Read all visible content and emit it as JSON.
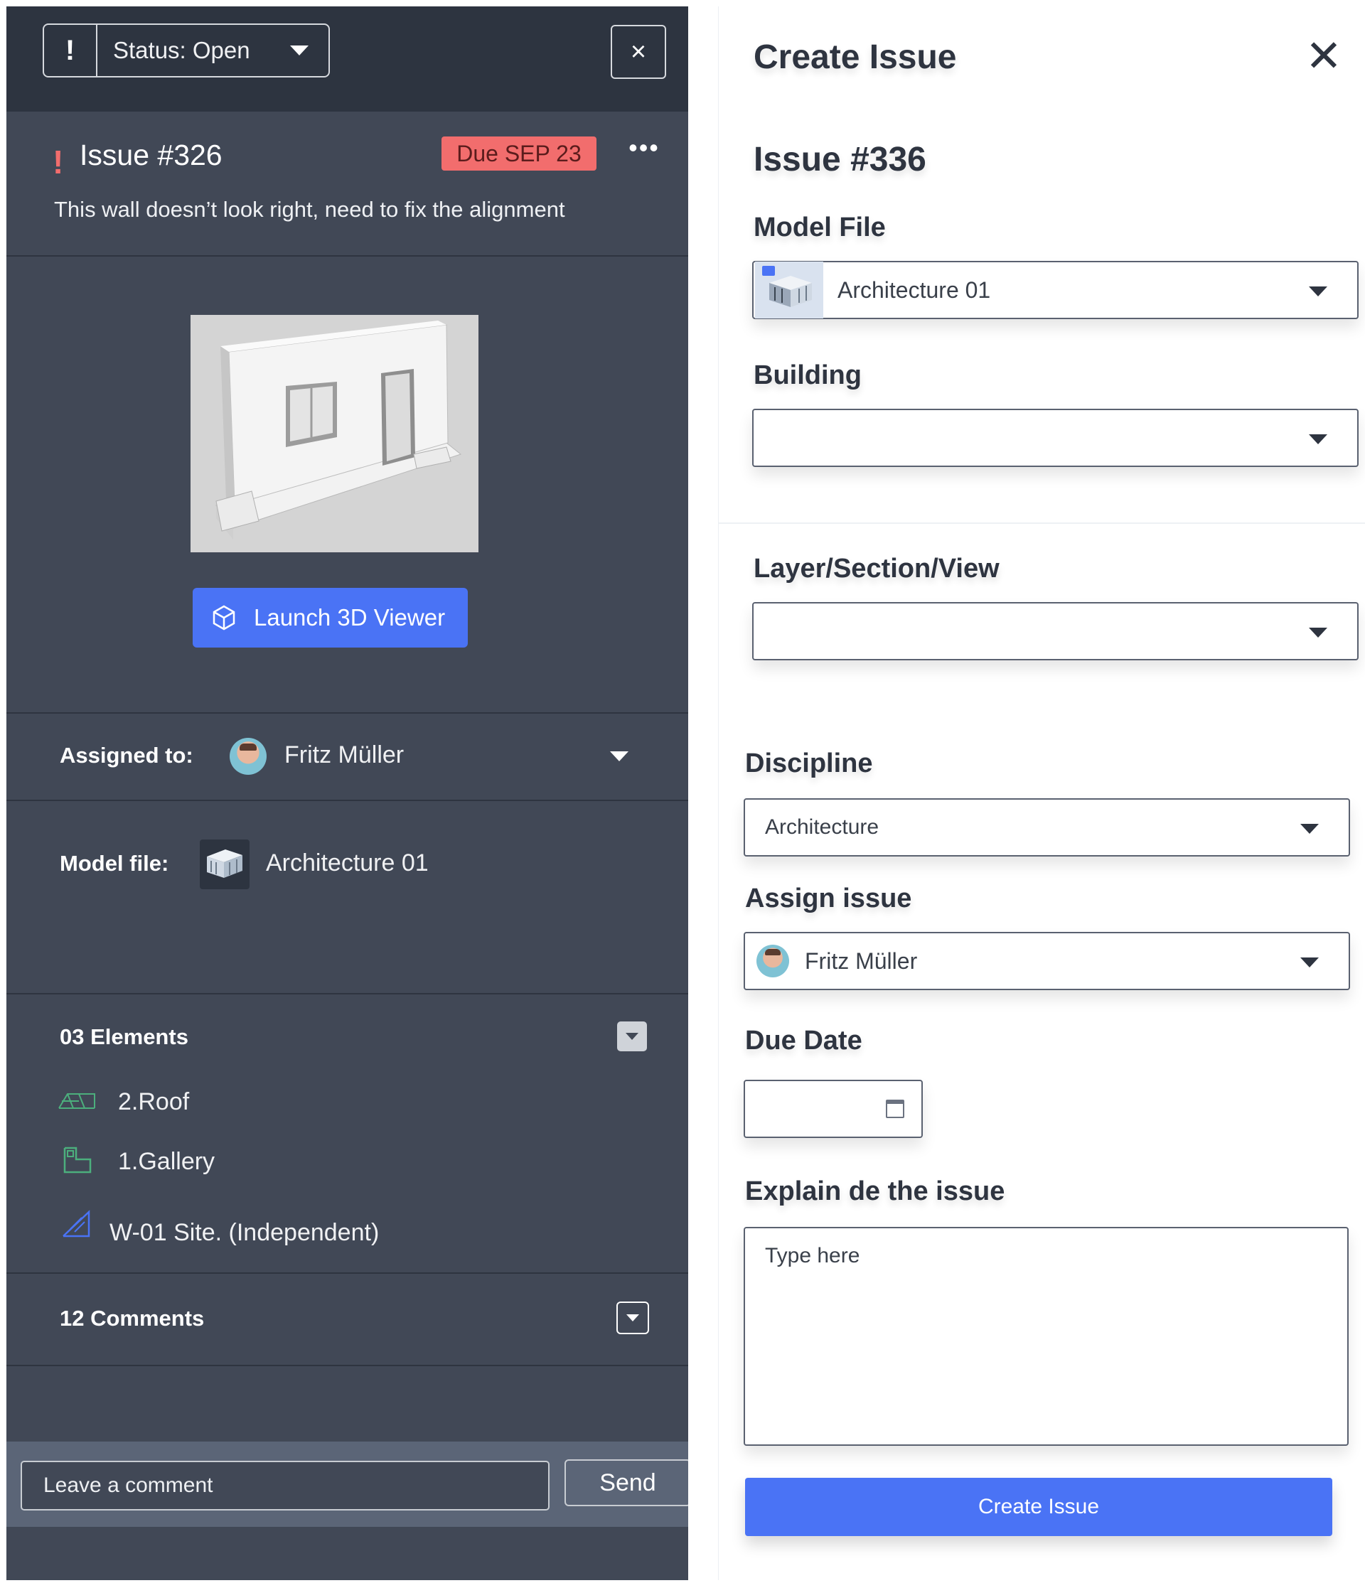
{
  "left_panel": {
    "status": {
      "alert_icon": "!",
      "label": "Status: Open"
    },
    "close_icon": "×",
    "issue": {
      "alert_icon": "!",
      "title": "Issue #326",
      "due_badge": "Due SEP 23",
      "more_icon": "•••",
      "description": "This wall doesn’t look right, need to fix the alignment"
    },
    "launch_button": "Launch 3D Viewer",
    "assigned": {
      "label": "Assigned to:",
      "name": "Fritz Müller"
    },
    "model_file": {
      "label": "Model file:",
      "name": "Architecture 01"
    },
    "elements": {
      "header": "03 Elements",
      "items": [
        {
          "label": "2.Roof",
          "icon": "roof-icon",
          "color": "#4caf7d"
        },
        {
          "label": "1.Gallery",
          "icon": "floor-plan-icon",
          "color": "#4caf7d"
        },
        {
          "label": "W-01 Site. (Independent)",
          "icon": "site-icon",
          "color": "#4a73f5"
        }
      ]
    },
    "comments": {
      "header": "12 Comments"
    },
    "comment_box": {
      "placeholder": "Leave a comment",
      "send": "Send"
    }
  },
  "right_panel": {
    "title": "Create Issue",
    "close_icon": "✕",
    "issue_number": "Issue #336",
    "model_file": {
      "label": "Model File",
      "value": "Architecture 01"
    },
    "building": {
      "label": "Building",
      "value": ""
    },
    "layer": {
      "label": "Layer/Section/View",
      "value": ""
    },
    "discipline": {
      "label": "Discipline",
      "value": "Architecture"
    },
    "assign": {
      "label": "Assign issue",
      "value": "Fritz Müller"
    },
    "due_date": {
      "label": "Due Date",
      "value": ""
    },
    "explain": {
      "label": "Explain de the issue",
      "placeholder": "Type here"
    },
    "create_button": "Create Issue"
  },
  "colors": {
    "accent_blue": "#4a73f5",
    "alert_red": "#f26d6d",
    "panel_dark": "#414856",
    "header_dark": "#2d3440"
  }
}
